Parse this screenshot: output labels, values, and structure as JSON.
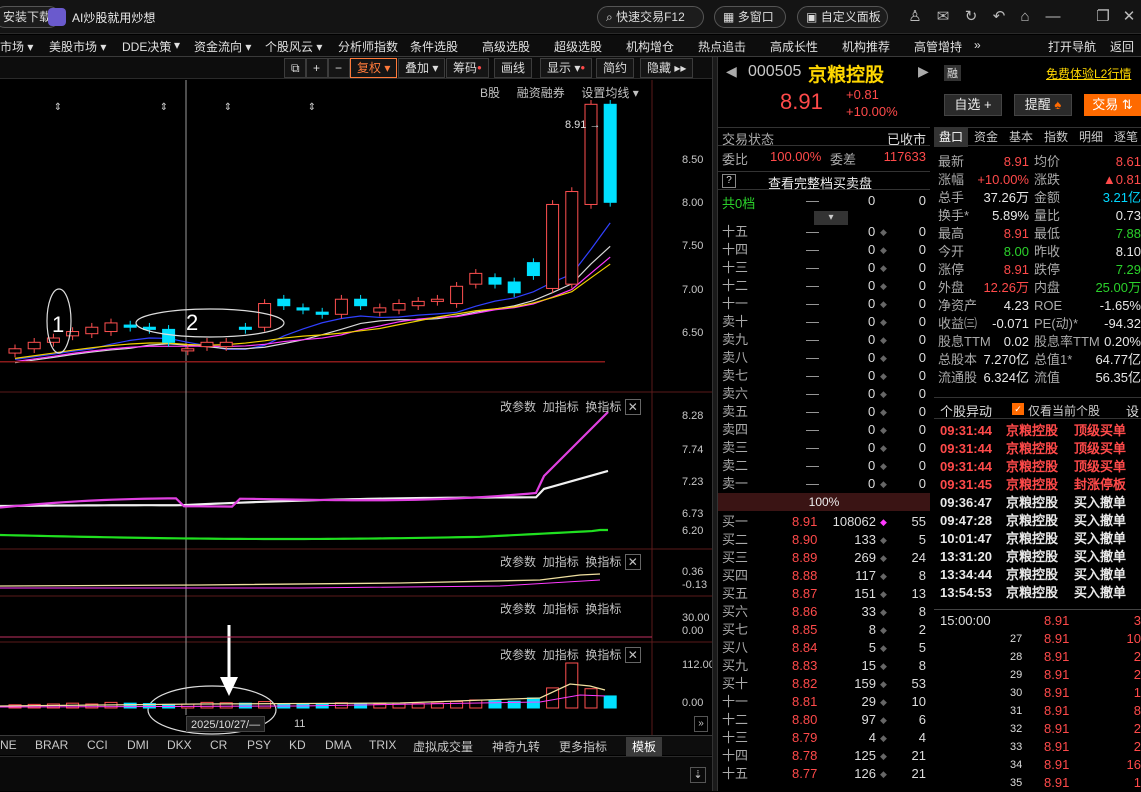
{
  "titlebar": {
    "download": "安装下载",
    "ai_label": "AI炒股就用炒想",
    "quick_trade": "快速交易F12",
    "multi_window": "多窗口",
    "custom_panel": "自定义面板"
  },
  "menu": [
    "市场 ▾",
    "美股市场 ▾",
    "DDE决策",
    "▾",
    "资金流向 ▾",
    "个股风云 ▾",
    "分析师指数",
    "条件选股",
    "高级选股",
    "超级选股",
    "机构增仓",
    "热点追击",
    "高成长性",
    "机构推荐",
    "高管增持",
    "»",
    "打开导航",
    "返回"
  ],
  "toolbar": {
    "fuquan": "复权",
    "overlay": "叠加",
    "chips": "筹码",
    "drawline": "画线",
    "display": "显示",
    "simple": "简约",
    "hide": "隐藏"
  },
  "chart": {
    "main_tabs": [
      "B股",
      "融资融券",
      "设置均线"
    ],
    "price_ticks": [
      "8.50",
      "8.00",
      "7.50",
      "7.00",
      "6.50"
    ],
    "high_label": "8.91",
    "annotations": [
      "1",
      "2"
    ],
    "pane_tools": [
      "改参数",
      "加指标",
      "换指标"
    ],
    "pane2_ticks": [
      "8.28",
      "7.74",
      "7.23",
      "6.73",
      "6.20"
    ],
    "pane3_ticks": [
      "0.36",
      "-0.13"
    ],
    "pane4_ticks": [
      "30.00",
      "0.00"
    ],
    "pane5_ticks": [
      "112.00",
      "0.00"
    ],
    "date_label": "2025/10/27/—",
    "month_label": "11"
  },
  "chart_data": {
    "type": "candlestick",
    "open": [
      6.6,
      6.64,
      6.7,
      6.76,
      6.78,
      6.8,
      6.86,
      6.84,
      6.82,
      6.62,
      6.66,
      6.66,
      6.84,
      6.84,
      7.1,
      7.02,
      6.98,
      6.96,
      7.1,
      6.98,
      7.0,
      7.04,
      7.08,
      7.06,
      7.24,
      7.3,
      7.26,
      7.44,
      7.2,
      7.24,
      7.98,
      8.91
    ],
    "close": [
      6.64,
      6.7,
      6.74,
      6.8,
      6.84,
      6.88,
      6.84,
      6.82,
      6.7,
      6.64,
      6.7,
      6.7,
      6.82,
      7.06,
      7.04,
      7.0,
      6.96,
      7.1,
      7.04,
      7.02,
      7.06,
      7.08,
      7.1,
      7.22,
      7.34,
      7.24,
      7.16,
      7.32,
      7.98,
      8.1,
      8.91,
      8.0
    ],
    "volume": [
      8,
      9,
      10,
      12,
      10,
      14,
      12,
      11,
      9,
      10,
      14,
      13,
      12,
      16,
      11,
      10,
      9,
      13,
      11,
      10,
      12,
      11,
      12,
      16,
      20,
      18,
      17,
      25,
      50,
      112,
      48,
      30
    ],
    "ma_series": [
      {
        "values": [
          6.62,
          6.64,
          6.66,
          6.68,
          6.7,
          6.72,
          6.74,
          6.78,
          6.82,
          6.86,
          6.9,
          6.96,
          7.04
        ]
      },
      {
        "values": [
          6.66,
          6.67,
          6.68,
          6.69,
          6.7,
          6.71,
          6.72,
          6.73,
          6.74,
          6.76,
          6.78,
          6.8,
          6.82
        ]
      }
    ],
    "ylim": [
      6.35,
      8.95
    ]
  },
  "bottom_tabs": [
    "NE",
    "BRAR",
    "CCI",
    "DMI",
    "DKX",
    "CR",
    "PSY",
    "KD",
    "DMA",
    "TRIX",
    "虚拟成交量",
    "神奇九转",
    "更多指标",
    "模板"
  ],
  "quote": {
    "code": "000505",
    "name": "京粮控股",
    "tag": "融",
    "l2": "免费体验L2行情",
    "price": "8.91",
    "change": "+0.81",
    "pct": "+10.00%",
    "btn_watch": "自选 +",
    "btn_alert": "提醒",
    "btn_trade": "交易",
    "status_label": "交易状态",
    "status_value": "已收市",
    "wb_label": "委比",
    "wb_value": "100.00%",
    "wc_label": "委差",
    "wc_value": "117633",
    "view_full": "查看完整档买卖盘",
    "total_levels": "共0档",
    "sell": [
      [
        "十五",
        "—",
        "0",
        "0"
      ],
      [
        "十四",
        "—",
        "0",
        "0"
      ],
      [
        "十三",
        "—",
        "0",
        "0"
      ],
      [
        "十二",
        "—",
        "0",
        "0"
      ],
      [
        "十一",
        "—",
        "0",
        "0"
      ],
      [
        "卖十",
        "—",
        "0",
        "0"
      ],
      [
        "卖九",
        "—",
        "0",
        "0"
      ],
      [
        "卖八",
        "—",
        "0",
        "0"
      ],
      [
        "卖七",
        "—",
        "0",
        "0"
      ],
      [
        "卖六",
        "—",
        "0",
        "0"
      ],
      [
        "卖五",
        "—",
        "0",
        "0"
      ],
      [
        "卖四",
        "—",
        "0",
        "0"
      ],
      [
        "卖三",
        "—",
        "0",
        "0"
      ],
      [
        "卖二",
        "—",
        "0",
        "0"
      ],
      [
        "卖一",
        "—",
        "0",
        "0"
      ]
    ],
    "mid_pct": "100%",
    "buy": [
      [
        "买一",
        "8.91",
        "108062",
        "55"
      ],
      [
        "买二",
        "8.90",
        "133",
        "5"
      ],
      [
        "买三",
        "8.89",
        "269",
        "24"
      ],
      [
        "买四",
        "8.88",
        "117",
        "8"
      ],
      [
        "买五",
        "8.87",
        "151",
        "13"
      ],
      [
        "买六",
        "8.86",
        "33",
        "8"
      ],
      [
        "买七",
        "8.85",
        "8",
        "2"
      ],
      [
        "买八",
        "8.84",
        "5",
        "5"
      ],
      [
        "买九",
        "8.83",
        "15",
        "8"
      ],
      [
        "买十",
        "8.82",
        "159",
        "53"
      ],
      [
        "十一",
        "8.81",
        "29",
        "10"
      ],
      [
        "十二",
        "8.80",
        "97",
        "6"
      ],
      [
        "十三",
        "8.79",
        "4",
        "4"
      ],
      [
        "十四",
        "8.78",
        "125",
        "21"
      ],
      [
        "十五",
        "8.77",
        "126",
        "21"
      ]
    ],
    "tabs": [
      "盘口",
      "资金",
      "基本",
      "指数",
      "明细",
      "逐笔"
    ],
    "stats": [
      [
        "最新",
        "8.91",
        "均价",
        "8.61"
      ],
      [
        "涨幅",
        "+10.00%",
        "涨跌",
        "▲0.81"
      ],
      [
        "总手",
        "37.26万",
        "金额",
        "3.21亿"
      ],
      [
        "换手*",
        "5.89%",
        "量比",
        "0.73"
      ],
      [
        "最高",
        "8.91",
        "最低",
        "7.88"
      ],
      [
        "今开",
        "8.00",
        "昨收",
        "8.10"
      ],
      [
        "涨停",
        "8.91",
        "跌停",
        "7.29"
      ],
      [
        "外盘",
        "12.26万",
        "内盘",
        "25.00万"
      ],
      [
        "净资产",
        "4.23",
        "ROE",
        "-1.65%"
      ],
      [
        "收益㈢",
        "-0.071",
        "PE(动)*",
        "-94.32"
      ],
      [
        "股息TTM",
        "0.02",
        "股息率TTM",
        "0.20%"
      ],
      [
        "总股本",
        "7.270亿",
        "总值1*",
        "64.77亿"
      ],
      [
        "流通股",
        "6.324亿",
        "流值",
        "56.35亿"
      ]
    ],
    "events_title": "个股异动",
    "events_only": "仅看当前个股",
    "events_set": "设",
    "events": [
      [
        "09:31:44",
        "京粮控股",
        "顶级买单"
      ],
      [
        "09:31:44",
        "京粮控股",
        "顶级买单"
      ],
      [
        "09:31:44",
        "京粮控股",
        "顶级买单"
      ],
      [
        "09:31:45",
        "京粮控股",
        "封涨停板"
      ],
      [
        "09:36:47",
        "京粮控股",
        "买入撤单"
      ],
      [
        "09:47:28",
        "京粮控股",
        "买入撤单"
      ],
      [
        "10:01:47",
        "京粮控股",
        "买入撤单"
      ],
      [
        "13:31:20",
        "京粮控股",
        "买入撤单"
      ],
      [
        "13:34:44",
        "京粮控股",
        "买入撤单"
      ],
      [
        "13:54:53",
        "京粮控股",
        "买入撤单"
      ]
    ],
    "ticks": [
      [
        "15:00:00",
        "8.91",
        "3"
      ],
      [
        "27",
        "8.91",
        "10"
      ],
      [
        "28",
        "8.91",
        "2"
      ],
      [
        "29",
        "8.91",
        "2"
      ],
      [
        "30",
        "8.91",
        "1"
      ],
      [
        "31",
        "8.91",
        "8"
      ],
      [
        "32",
        "8.91",
        "2"
      ],
      [
        "33",
        "8.91",
        "2"
      ],
      [
        "34",
        "8.91",
        "16"
      ],
      [
        "35",
        "8.91",
        "1"
      ]
    ]
  },
  "colors": {
    "up": "#ff4a4a",
    "down": "#00e0ff",
    "bg": "#000000",
    "accent": "#ff6a00"
  }
}
